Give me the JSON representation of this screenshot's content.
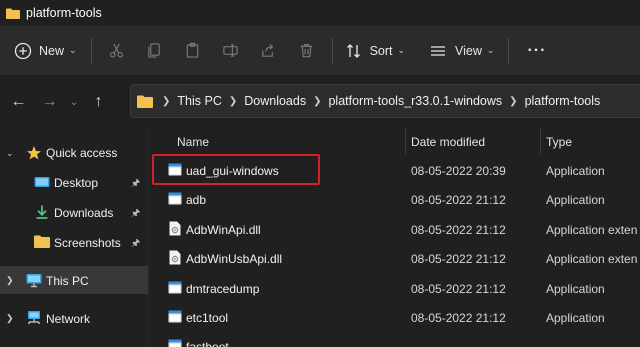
{
  "window": {
    "title": "platform-tools"
  },
  "toolbar": {
    "new_label": "New",
    "sort_label": "Sort",
    "view_label": "View",
    "more_label": "···"
  },
  "address": {
    "crumbs": [
      "This PC",
      "Downloads",
      "platform-tools_r33.0.1-windows",
      "platform-tools"
    ]
  },
  "sidebar": {
    "items": [
      {
        "label": "Quick access",
        "icon": "star-icon",
        "pinned": false
      },
      {
        "label": "Desktop",
        "icon": "desktop-folder-icon",
        "pinned": true
      },
      {
        "label": "Downloads",
        "icon": "download-icon",
        "pinned": true
      },
      {
        "label": "Screenshots",
        "icon": "folder-icon",
        "pinned": true
      },
      {
        "label": "This PC",
        "icon": "computer-icon",
        "pinned": false
      },
      {
        "label": "Network",
        "icon": "network-icon",
        "pinned": false
      }
    ]
  },
  "files": {
    "columns": {
      "name": "Name",
      "date": "Date modified",
      "type": "Type"
    },
    "rows": [
      {
        "name": "uad_gui-windows",
        "date": "08-05-2022 20:39",
        "type": "Application",
        "icon": "application-icon"
      },
      {
        "name": "adb",
        "date": "08-05-2022 21:12",
        "type": "Application",
        "icon": "application-icon"
      },
      {
        "name": "AdbWinApi.dll",
        "date": "08-05-2022 21:12",
        "type": "Application exten",
        "icon": "dll-file-icon"
      },
      {
        "name": "AdbWinUsbApi.dll",
        "date": "08-05-2022 21:12",
        "type": "Application exten",
        "icon": "dll-file-icon"
      },
      {
        "name": "dmtracedump",
        "date": "08-05-2022 21:12",
        "type": "Application",
        "icon": "application-icon"
      },
      {
        "name": "etc1tool",
        "date": "08-05-2022 21:12",
        "type": "Application",
        "icon": "application-icon"
      },
      {
        "name": "fastboot",
        "date": "",
        "type": "",
        "icon": "application-icon"
      }
    ]
  },
  "colors": {
    "background": "#202020",
    "toolbar": "#2b2b2b",
    "highlight_border": "#d81f2a",
    "folder": "#f2c14e",
    "accent_blue": "#4cc2ff"
  }
}
